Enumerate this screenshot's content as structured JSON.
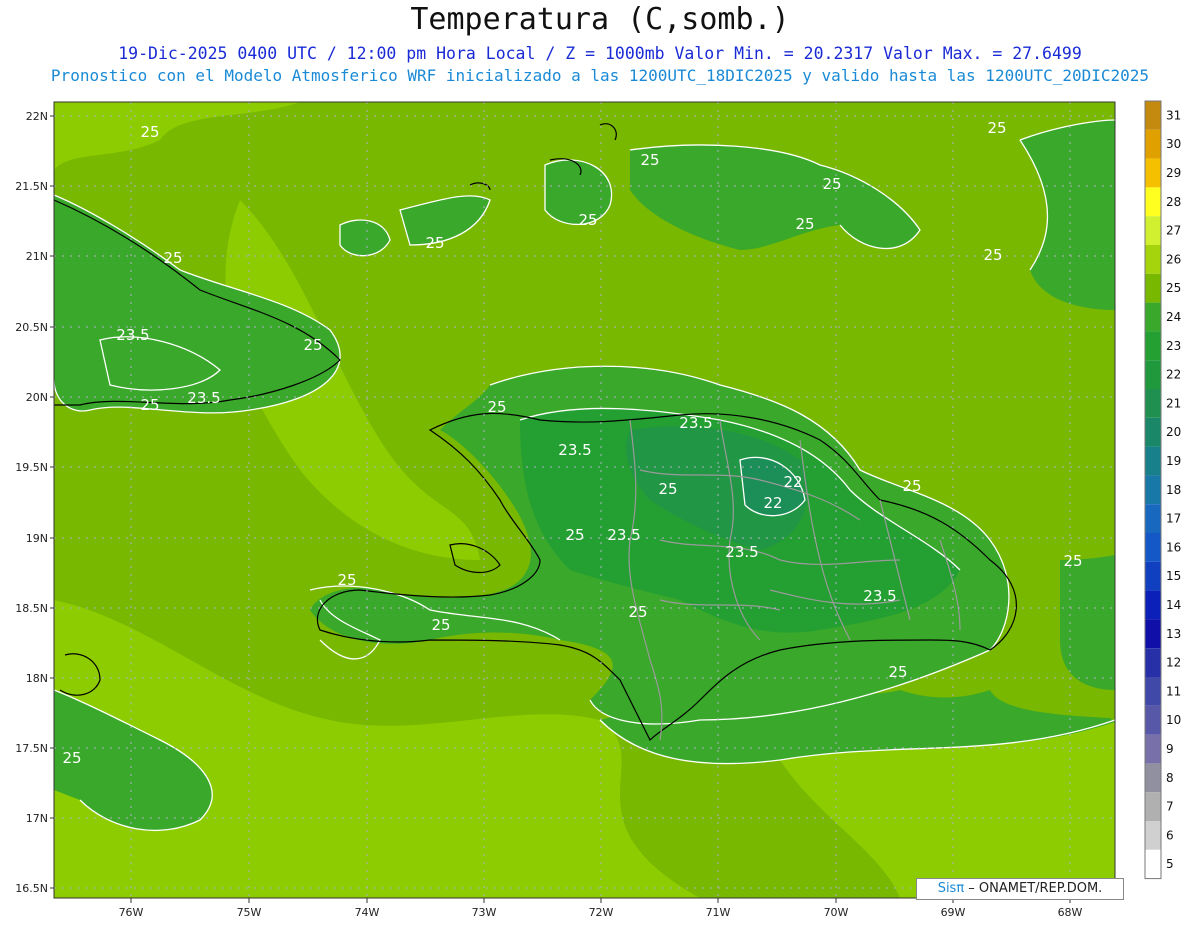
{
  "title": "Temperatura (C,somb.)",
  "subtitle_line1": "19-Dic-2025 0400 UTC / 12:00 pm Hora Local / Z = 1000mb  Valor Min. = 20.2317  Valor Max. = 27.6499",
  "subtitle_line2": "Pronostico con el Modelo Atmosferico WRF inicializado a las 1200UTC_18DIC2025 y valido hasta las  1200UTC_20DIC2025",
  "lat_labels": [
    "22N",
    "21.5N",
    "21N",
    "20.5N",
    "20N",
    "19.5N",
    "19N",
    "18.5N",
    "18N",
    "17.5N",
    "17N",
    "16.5N"
  ],
  "lon_labels": [
    "76W",
    "75W",
    "74W",
    "73W",
    "72W",
    "71W",
    "70W",
    "69W",
    "68W"
  ],
  "colorbar_levels": [
    "31",
    "30",
    "29",
    "28",
    "27",
    "26",
    "25",
    "24",
    "23",
    "22",
    "21",
    "20",
    "19",
    "18",
    "17",
    "16",
    "15",
    "14",
    "13",
    "12",
    "11",
    "10",
    "9",
    "8",
    "7",
    "6",
    "5"
  ],
  "colorbar_colors": [
    "#c48a10",
    "#e0a000",
    "#f5c000",
    "#ffff20",
    "#d0f030",
    "#a6d40c",
    "#78b800",
    "#3aa82a",
    "#24a032",
    "#20983c",
    "#209050",
    "#1a8868",
    "#18808a",
    "#1878a8",
    "#1868c0",
    "#1458c8",
    "#1040c0",
    "#0a20b8",
    "#1010a8",
    "#2830a8",
    "#4048a8",
    "#5858a8",
    "#7870a8",
    "#9090a0",
    "#b0b0b0",
    "#d0d0d0",
    "#ffffff"
  ],
  "contour_labels": [
    "25",
    "25",
    "25",
    "25",
    "25",
    "25",
    "25",
    "25",
    "25",
    "25",
    "25",
    "25",
    "25",
    "25",
    "25",
    "25",
    "25",
    "23.5",
    "23.5",
    "23.5",
    "23.5",
    "23.5",
    "23.5",
    "23.5",
    "22",
    "22"
  ],
  "footer": {
    "brand": "Sisπ",
    "text": " – ONAMET/REP.DOM."
  }
}
